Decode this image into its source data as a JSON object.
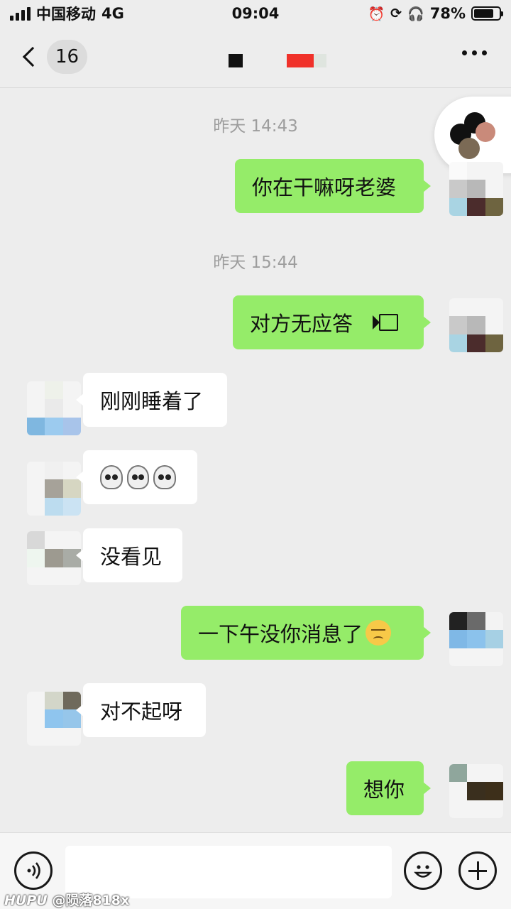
{
  "status_bar": {
    "carrier": "中国移动",
    "network": "4G",
    "time": "09:04",
    "battery_percent_text": "78%",
    "battery_level": 0.78,
    "icons": [
      "alarm-icon",
      "rotation-lock-icon",
      "headphones-icon",
      "battery-icon"
    ]
  },
  "nav": {
    "unread_count": "16",
    "back_icon": "chevron-left-icon",
    "more_icon": "more-dots-icon"
  },
  "messages": {
    "ts1": "昨天 14:43",
    "m1": "你在干嘛呀老婆",
    "ts2": "昨天 15:44",
    "m2": "对方无应答",
    "m3": "刚刚睡着了",
    "m4_emoji": [
      "skull-emoji",
      "skull-emoji",
      "skull-emoji"
    ],
    "m5": "没看见",
    "m6": "一下午没你消息了",
    "m6_emoji": "pensive-face-emoji",
    "m7": "对不起呀",
    "m8": "想你"
  },
  "input_bar": {
    "voice_icon": "voice-input-icon",
    "input_value": "",
    "emoji_icon": "emoji-icon",
    "plus_icon": "plus-icon"
  },
  "watermark": {
    "brand": "HUPU",
    "user": "@陨落818x"
  },
  "colors": {
    "background": "#ededed",
    "my_bubble": "#95ec69",
    "their_bubble": "#ffffff",
    "timestamp": "#9d9d9d"
  }
}
